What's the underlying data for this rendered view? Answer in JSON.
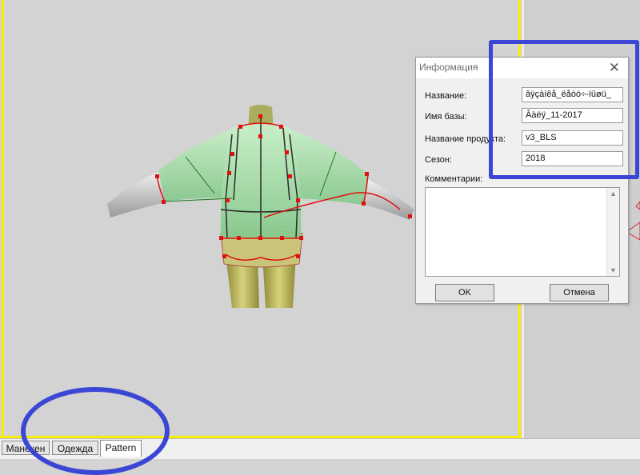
{
  "dialog": {
    "title": "Информация",
    "fields": [
      {
        "label": "Название:",
        "value": "âÿçàíêå_ëåòó÷-ïûøü_"
      },
      {
        "label": "Имя базы:",
        "value": "Âàëÿ_11-2017"
      },
      {
        "label": "Название продукта:",
        "value": "v3_BLS"
      },
      {
        "label": "Сезон:",
        "value": "2018"
      }
    ],
    "comments_label": "Комментарии:",
    "comments_value": "",
    "ok_label": "OK",
    "cancel_label": "Отмена"
  },
  "tabs": [
    {
      "label": "Манекен"
    },
    {
      "label": "Одежда"
    },
    {
      "label": "Pattern"
    }
  ],
  "colors": {
    "viewport_bg": "#d3d3d3",
    "frame_yellow": "#f6f000",
    "highlight_blue": "#3b47d4",
    "pattern_red": "#e01010",
    "garment_green": "#9fe0a0",
    "mannequin_olive": "#b7b35a"
  }
}
